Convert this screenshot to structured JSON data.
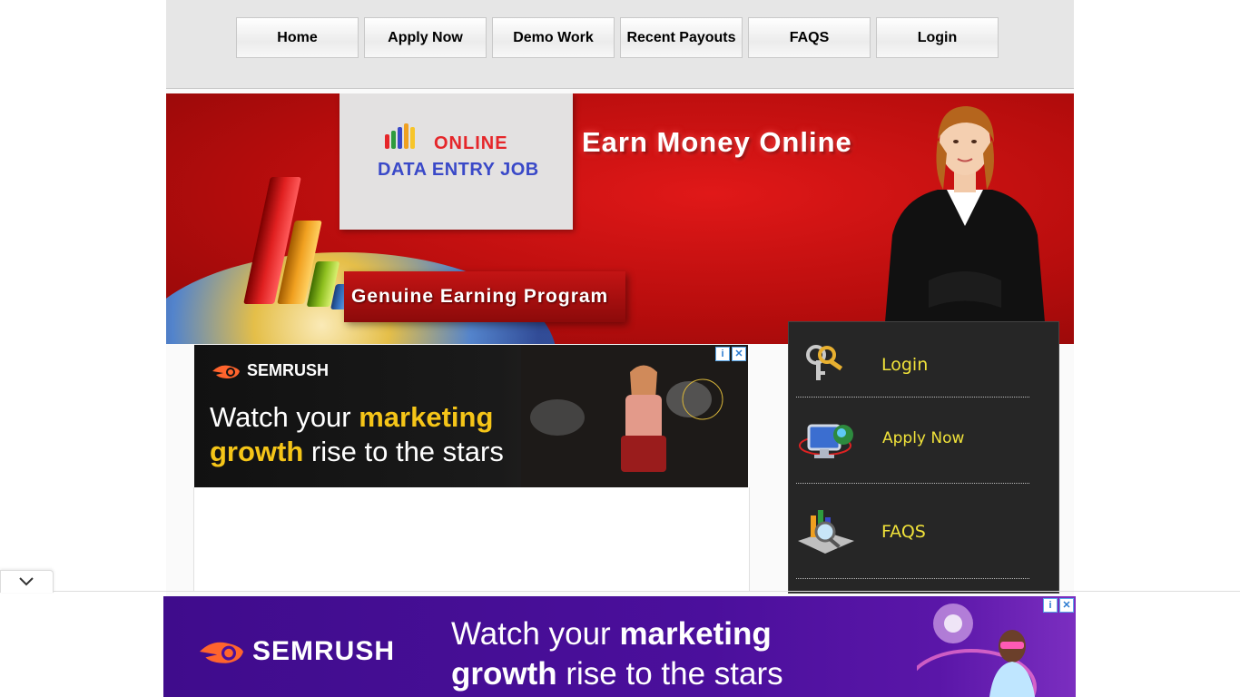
{
  "nav": {
    "items": [
      "Home",
      "Apply Now",
      "Demo Work",
      "Recent Payouts",
      "FAQS",
      "Login"
    ]
  },
  "banner": {
    "logo_line1": "ONLINE",
    "logo_line2": "DATA ENTRY JOB",
    "headline": "Earn Money Online",
    "tagline": "Genuine Earning Program"
  },
  "top_ad": {
    "brand": "SEMRUSH",
    "line1_plain": "Watch your ",
    "line1_bold": "marketing",
    "line2_bold": "growth",
    "line2_plain": " rise to the stars"
  },
  "side_menu": {
    "items": [
      {
        "label": "Login",
        "icon": "keys-icon"
      },
      {
        "label": "Apply Now",
        "icon": "computer-globe-icon"
      },
      {
        "label": "FAQS",
        "icon": "magnifier-icon"
      }
    ]
  },
  "bottom_ad": {
    "brand": "SEMRUSH",
    "line1_plain": "Watch your ",
    "line1_bold": "marketing",
    "line2_bold": "growth",
    "line2_plain": " rise to the stars"
  },
  "colors": {
    "banner_red": "#c41414",
    "menu_text": "#f0e23a",
    "ad_purple": "#4b0f9c",
    "ad_yellow": "#f5c518"
  }
}
